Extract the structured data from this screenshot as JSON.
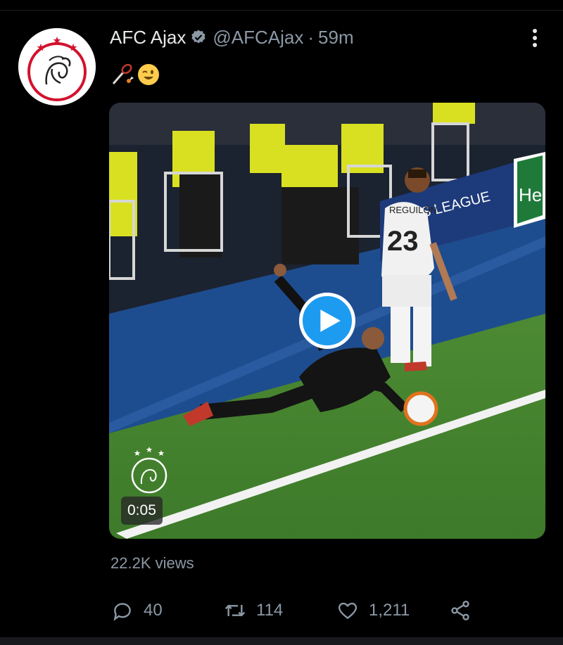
{
  "tweet": {
    "display_name": "AFC Ajax",
    "handle": "@AFCAjax",
    "separator": "·",
    "time": "59m",
    "text_emoji": "🏸😉",
    "verified_icon": "verified-badge-icon",
    "more_icon": "vertical-ellipsis-icon"
  },
  "media": {
    "type": "video",
    "duration": "0:05",
    "play_icon": "play-icon",
    "scene_text": {
      "player_name": "REGUILÓN",
      "player_number": "23",
      "board_text": "PIONS LEAGUE",
      "board_text_2": "Hei"
    }
  },
  "stats": {
    "views_count": "22.2K",
    "views_label": "views"
  },
  "actions": {
    "reply_count": "40",
    "retweet_count": "114",
    "like_count": "1,211",
    "reply_icon": "reply-icon",
    "retweet_icon": "retweet-icon",
    "like_icon": "heart-icon",
    "share_icon": "share-icon"
  },
  "colors": {
    "background": "#000000",
    "text": "#e7e9ea",
    "muted": "#8b98a5",
    "accent": "#1d9bf0",
    "ajax_red": "#d2122e"
  }
}
